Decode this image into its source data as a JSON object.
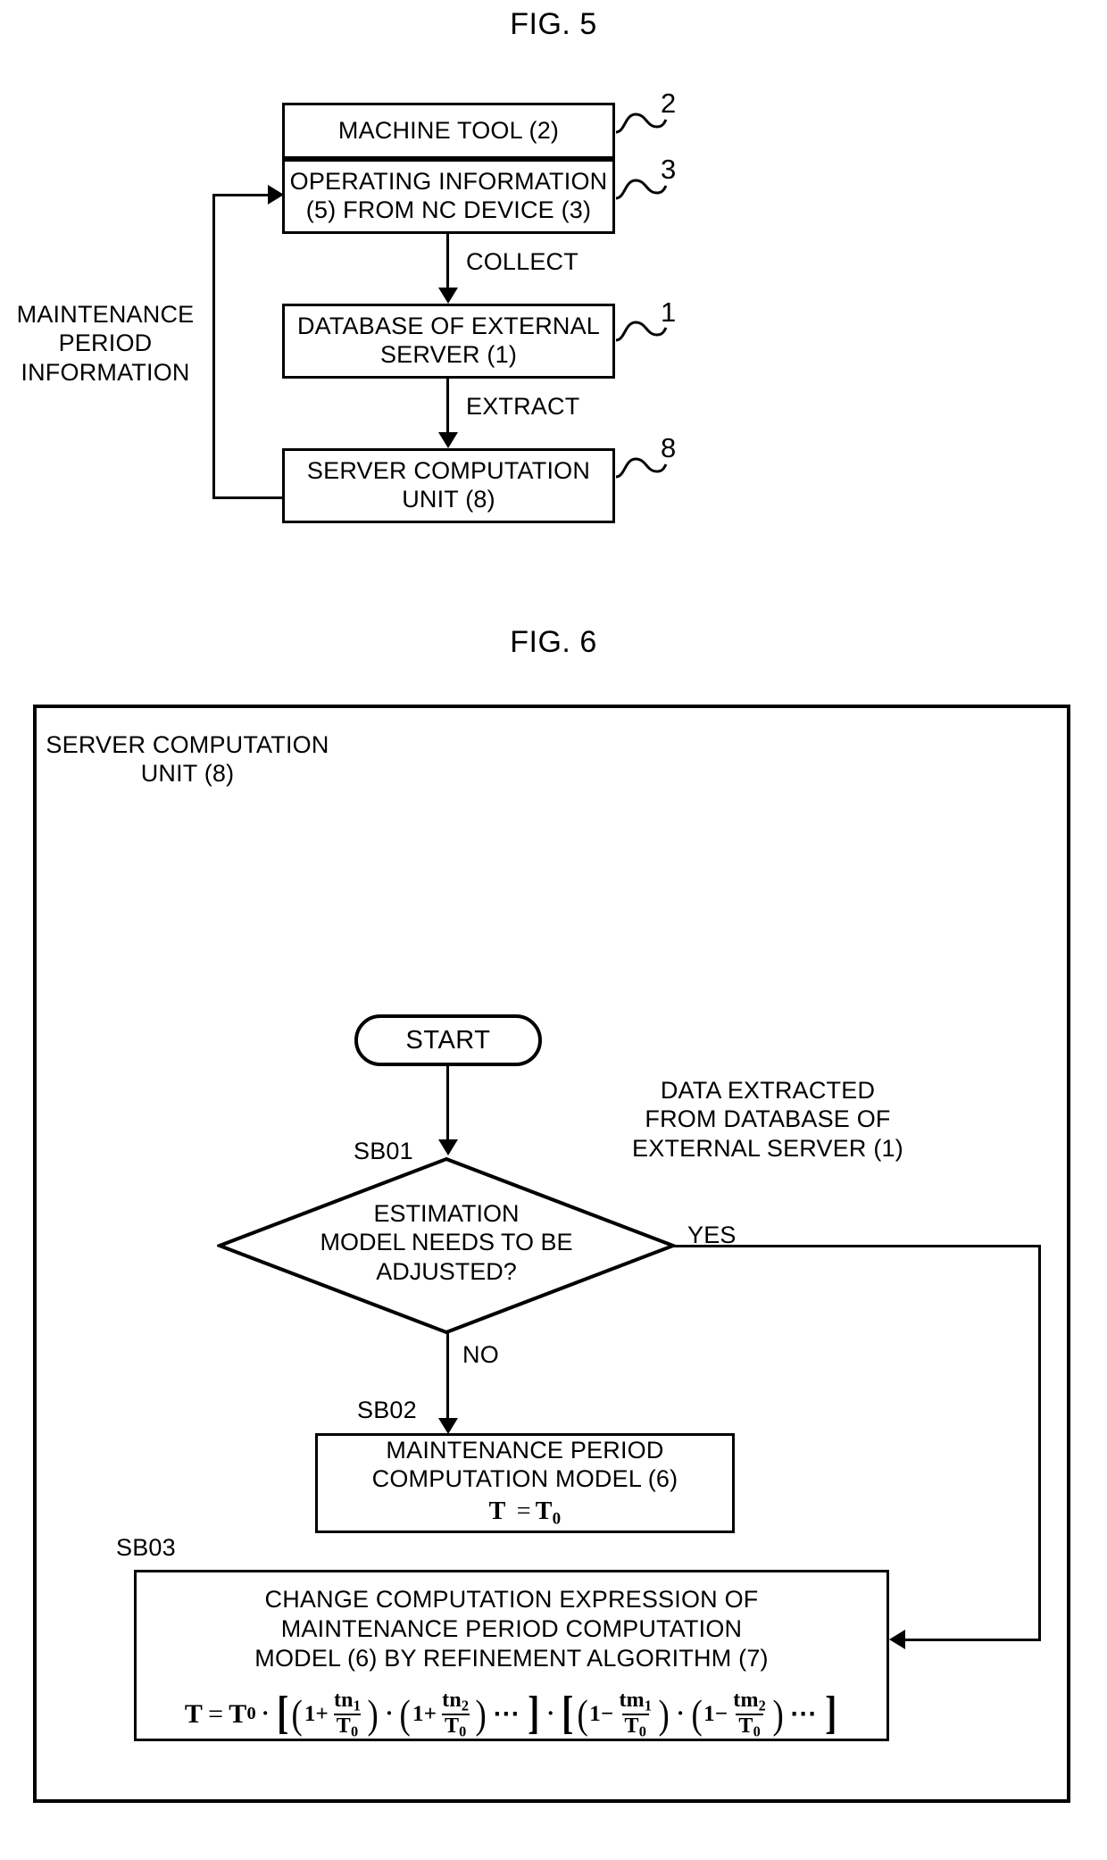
{
  "figures": [
    {
      "id": "fig5",
      "title": "FIG. 5",
      "boxes": [
        {
          "key": "machine_tool",
          "text": "MACHINE TOOL (2)",
          "ref": "2"
        },
        {
          "key": "operating_info",
          "text": "OPERATING INFORMATION\n(5) FROM NC DEVICE (3)",
          "ref": "3"
        },
        {
          "key": "database",
          "text": "DATABASE OF EXTERNAL\nSERVER (1)",
          "ref": "1"
        },
        {
          "key": "server_computation",
          "text": "SERVER COMPUTATION\nUNIT (8)",
          "ref": "8"
        }
      ],
      "edge_labels": {
        "collect": "COLLECT",
        "extract": "EXTRACT",
        "feedback": "MAINTENANCE\nPERIOD\nINFORMATION"
      }
    },
    {
      "id": "fig6",
      "title": "FIG. 6",
      "frame_label": "SERVER COMPUTATION\nUNIT (8)",
      "start_label": "START",
      "annotation": "DATA EXTRACTED\nFROM DATABASE OF\nEXTERNAL SERVER (1)",
      "steps": [
        {
          "tag": "SB01",
          "kind": "decision",
          "text": "ESTIMATION\nMODEL NEEDS TO BE\nADJUSTED?"
        },
        {
          "tag": "SB02",
          "kind": "process",
          "text": "MAINTENANCE PERIOD\nCOMPUTATION MODEL (6)",
          "equation": "T = T0"
        },
        {
          "tag": "SB03",
          "kind": "process",
          "text": "CHANGE COMPUTATION EXPRESSION OF\nMAINTENANCE PERIOD COMPUTATION\nMODEL (6) BY REFINEMENT ALGORITHM (7)"
        }
      ],
      "branch_labels": {
        "yes": "YES",
        "no": "NO"
      },
      "equation_sb02": {
        "lhs": "T",
        "eq": "=",
        "rhs_base": "T",
        "rhs_sub": "0"
      },
      "equation_sb03": {
        "lhs": "T",
        "eq": "=",
        "t0": "T",
        "t0_sub": "0",
        "terms_group1": [
          {
            "sign": "1+",
            "num": "tn",
            "num_sub": "1",
            "den": "T",
            "den_sub": "0"
          },
          {
            "sign": "1+",
            "num": "tn",
            "num_sub": "2",
            "den": "T",
            "den_sub": "0"
          }
        ],
        "terms_group2": [
          {
            "sign": "1−",
            "num": "tm",
            "num_sub": "1",
            "den": "T",
            "den_sub": "0"
          },
          {
            "sign": "1−",
            "num": "tm",
            "num_sub": "2",
            "den": "T",
            "den_sub": "0"
          }
        ],
        "ellipsis": "⋯"
      }
    }
  ],
  "colors": {
    "ink": "#000000",
    "paper": "#ffffff"
  }
}
